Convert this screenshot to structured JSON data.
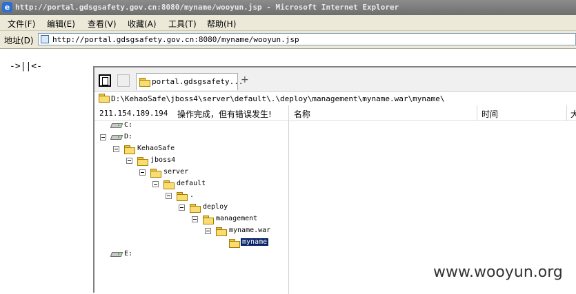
{
  "window": {
    "title": "http://portal.gdsgsafety.gov.cn:8080/myname/wooyun.jsp - Microsoft Internet Explorer"
  },
  "menu": [
    "文件(F)",
    "编辑(E)",
    "查看(V)",
    "收藏(A)",
    "工具(T)",
    "帮助(H)"
  ],
  "address": {
    "label": "地址(D)",
    "url": "http://portal.gdsgsafety.gov.cn:8080/myname/wooyun.jsp"
  },
  "page": {
    "text": "->||<-"
  },
  "manager": {
    "tab_label": "portal.gdsgsafety...",
    "tab_add": "+",
    "path": "D:\\KehaoSafe\\jboss4\\server\\default\\.\\deploy\\management\\myname.war\\myname\\",
    "ip": "211.154.189.194",
    "status": "操作完成，但有错误发生!",
    "columns": [
      "名称",
      "时间",
      "大"
    ],
    "tree": [
      "C:",
      "D:",
      "KehaoSafe",
      "jboss4",
      "server",
      "default",
      ".",
      "deploy",
      "management",
      "myname.war",
      "myname",
      "E:"
    ]
  },
  "watermark": "www.wooyun.org",
  "icons": {
    "ie": "internet-explorer-icon",
    "page": "page-icon",
    "folder": "folder-icon",
    "drive": "drive-icon"
  }
}
